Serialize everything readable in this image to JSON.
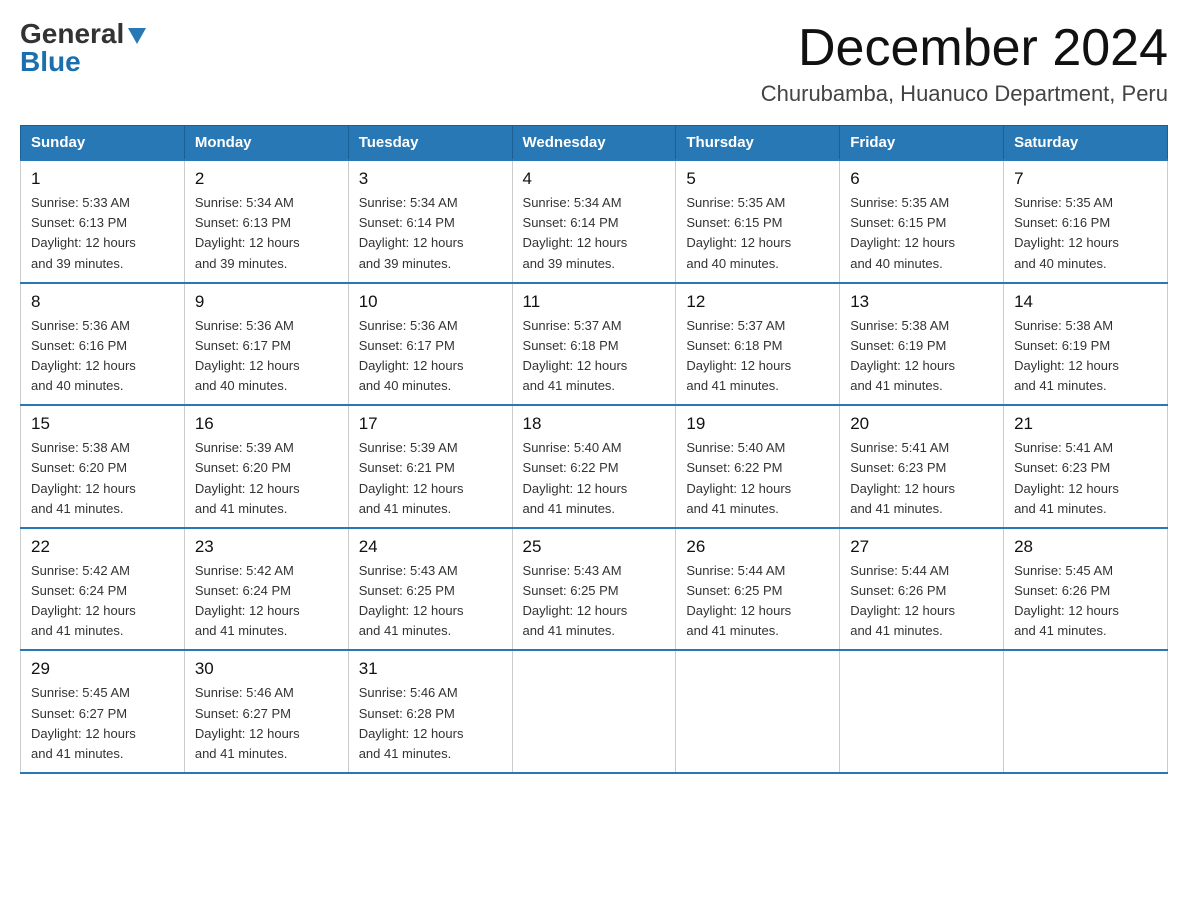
{
  "logo": {
    "general": "General",
    "blue": "Blue"
  },
  "title": "December 2024",
  "subtitle": "Churubamba, Huanuco Department, Peru",
  "days_header": [
    "Sunday",
    "Monday",
    "Tuesday",
    "Wednesday",
    "Thursday",
    "Friday",
    "Saturday"
  ],
  "weeks": [
    [
      {
        "day": "1",
        "sunrise": "5:33 AM",
        "sunset": "6:13 PM",
        "daylight": "12 hours and 39 minutes."
      },
      {
        "day": "2",
        "sunrise": "5:34 AM",
        "sunset": "6:13 PM",
        "daylight": "12 hours and 39 minutes."
      },
      {
        "day": "3",
        "sunrise": "5:34 AM",
        "sunset": "6:14 PM",
        "daylight": "12 hours and 39 minutes."
      },
      {
        "day": "4",
        "sunrise": "5:34 AM",
        "sunset": "6:14 PM",
        "daylight": "12 hours and 39 minutes."
      },
      {
        "day": "5",
        "sunrise": "5:35 AM",
        "sunset": "6:15 PM",
        "daylight": "12 hours and 40 minutes."
      },
      {
        "day": "6",
        "sunrise": "5:35 AM",
        "sunset": "6:15 PM",
        "daylight": "12 hours and 40 minutes."
      },
      {
        "day": "7",
        "sunrise": "5:35 AM",
        "sunset": "6:16 PM",
        "daylight": "12 hours and 40 minutes."
      }
    ],
    [
      {
        "day": "8",
        "sunrise": "5:36 AM",
        "sunset": "6:16 PM",
        "daylight": "12 hours and 40 minutes."
      },
      {
        "day": "9",
        "sunrise": "5:36 AM",
        "sunset": "6:17 PM",
        "daylight": "12 hours and 40 minutes."
      },
      {
        "day": "10",
        "sunrise": "5:36 AM",
        "sunset": "6:17 PM",
        "daylight": "12 hours and 40 minutes."
      },
      {
        "day": "11",
        "sunrise": "5:37 AM",
        "sunset": "6:18 PM",
        "daylight": "12 hours and 41 minutes."
      },
      {
        "day": "12",
        "sunrise": "5:37 AM",
        "sunset": "6:18 PM",
        "daylight": "12 hours and 41 minutes."
      },
      {
        "day": "13",
        "sunrise": "5:38 AM",
        "sunset": "6:19 PM",
        "daylight": "12 hours and 41 minutes."
      },
      {
        "day": "14",
        "sunrise": "5:38 AM",
        "sunset": "6:19 PM",
        "daylight": "12 hours and 41 minutes."
      }
    ],
    [
      {
        "day": "15",
        "sunrise": "5:38 AM",
        "sunset": "6:20 PM",
        "daylight": "12 hours and 41 minutes."
      },
      {
        "day": "16",
        "sunrise": "5:39 AM",
        "sunset": "6:20 PM",
        "daylight": "12 hours and 41 minutes."
      },
      {
        "day": "17",
        "sunrise": "5:39 AM",
        "sunset": "6:21 PM",
        "daylight": "12 hours and 41 minutes."
      },
      {
        "day": "18",
        "sunrise": "5:40 AM",
        "sunset": "6:22 PM",
        "daylight": "12 hours and 41 minutes."
      },
      {
        "day": "19",
        "sunrise": "5:40 AM",
        "sunset": "6:22 PM",
        "daylight": "12 hours and 41 minutes."
      },
      {
        "day": "20",
        "sunrise": "5:41 AM",
        "sunset": "6:23 PM",
        "daylight": "12 hours and 41 minutes."
      },
      {
        "day": "21",
        "sunrise": "5:41 AM",
        "sunset": "6:23 PM",
        "daylight": "12 hours and 41 minutes."
      }
    ],
    [
      {
        "day": "22",
        "sunrise": "5:42 AM",
        "sunset": "6:24 PM",
        "daylight": "12 hours and 41 minutes."
      },
      {
        "day": "23",
        "sunrise": "5:42 AM",
        "sunset": "6:24 PM",
        "daylight": "12 hours and 41 minutes."
      },
      {
        "day": "24",
        "sunrise": "5:43 AM",
        "sunset": "6:25 PM",
        "daylight": "12 hours and 41 minutes."
      },
      {
        "day": "25",
        "sunrise": "5:43 AM",
        "sunset": "6:25 PM",
        "daylight": "12 hours and 41 minutes."
      },
      {
        "day": "26",
        "sunrise": "5:44 AM",
        "sunset": "6:25 PM",
        "daylight": "12 hours and 41 minutes."
      },
      {
        "day": "27",
        "sunrise": "5:44 AM",
        "sunset": "6:26 PM",
        "daylight": "12 hours and 41 minutes."
      },
      {
        "day": "28",
        "sunrise": "5:45 AM",
        "sunset": "6:26 PM",
        "daylight": "12 hours and 41 minutes."
      }
    ],
    [
      {
        "day": "29",
        "sunrise": "5:45 AM",
        "sunset": "6:27 PM",
        "daylight": "12 hours and 41 minutes."
      },
      {
        "day": "30",
        "sunrise": "5:46 AM",
        "sunset": "6:27 PM",
        "daylight": "12 hours and 41 minutes."
      },
      {
        "day": "31",
        "sunrise": "5:46 AM",
        "sunset": "6:28 PM",
        "daylight": "12 hours and 41 minutes."
      },
      null,
      null,
      null,
      null
    ]
  ],
  "labels": {
    "sunrise": "Sunrise:",
    "sunset": "Sunset:",
    "daylight": "Daylight:"
  }
}
